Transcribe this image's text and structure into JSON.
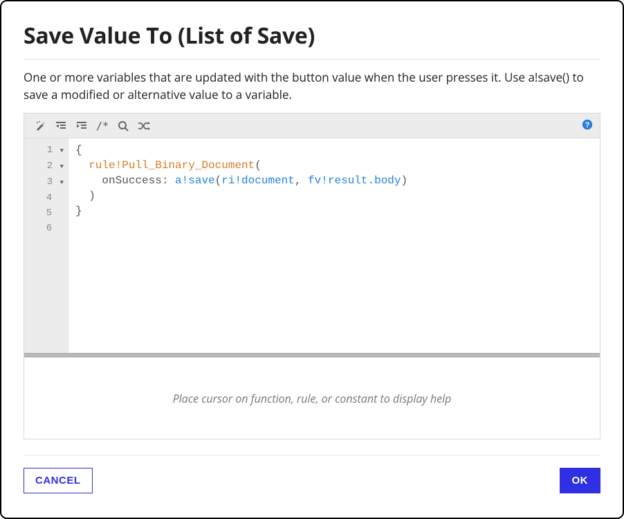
{
  "dialog": {
    "title": "Save Value To (List of Save)",
    "description": "One or more variables that are updated with the button value when the user presses it. Use a!save() to save a modified or alternative value to a variable."
  },
  "toolbar": {
    "icons": {
      "wand": "format-wand-icon",
      "outdent": "outdent-icon",
      "indent": "indent-icon",
      "comment": "comment-block-icon",
      "search": "search-icon",
      "shuffle": "shuffle-icon",
      "help": "help-icon"
    },
    "comment_glyph": "/*"
  },
  "editor": {
    "lines": [
      {
        "num": "1",
        "fold": true
      },
      {
        "num": "2",
        "fold": true
      },
      {
        "num": "3",
        "fold": true
      },
      {
        "num": "4",
        "fold": false
      },
      {
        "num": "5",
        "fold": false
      },
      {
        "num": "6",
        "fold": false
      }
    ],
    "code": {
      "l1": "{",
      "l2_rule": "rule!Pull_Binary_Document",
      "l2_paren": "(",
      "l3_key": "onSuccess",
      "l3_colon": ": ",
      "l3_fn": "a!save",
      "l3_open": "(",
      "l3_arg1": "ri!document",
      "l3_comma": ", ",
      "l3_arg2": "fv!result.body",
      "l3_close": ")",
      "l4": ")",
      "l5": "}"
    }
  },
  "help_hint": "Place cursor on function, rule, or constant to display help",
  "buttons": {
    "cancel": "CANCEL",
    "ok": "OK"
  }
}
